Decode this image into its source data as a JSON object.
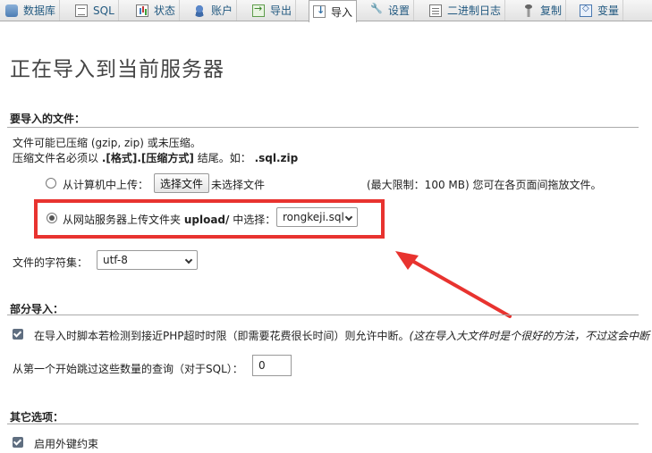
{
  "tabs": [
    {
      "label": "数据库",
      "icon": "database-icon"
    },
    {
      "label": "SQL",
      "icon": "sql-icon"
    },
    {
      "label": "状态",
      "icon": "status-icon"
    },
    {
      "label": "账户",
      "icon": "user-icon"
    },
    {
      "label": "导出",
      "icon": "export-icon"
    },
    {
      "label": "导入",
      "icon": "import-icon",
      "active": true
    },
    {
      "label": "设置",
      "icon": "wrench-icon"
    },
    {
      "label": "二进制日志",
      "icon": "binlog-icon"
    },
    {
      "label": "复制",
      "icon": "replication-icon"
    },
    {
      "label": "变量",
      "icon": "variables-icon"
    }
  ],
  "page_title": "正在导入到当前服务器",
  "file_section": {
    "heading": "要导入的文件：",
    "note_line1": "文件可能已压缩 (gzip, zip) 或未压缩。",
    "note_line2_prefix": "压缩文件名必须以",
    "note_line2_format": ".[格式].[压缩方式]",
    "note_line2_mid": "结尾。如：",
    "note_line2_example": ".sql.zip",
    "upload_from_computer_label": "从计算机中上传：",
    "choose_file_button": "选择文件",
    "no_file_selected": "未选择文件",
    "max_limit_text": "(最大限制：100 MB) 您可在各页面间拖放文件。",
    "upload_from_server_prefix": "从网站服务器上传文件夹",
    "upload_dir": "upload/",
    "upload_from_server_suffix": "中选择：",
    "server_file_selected": "rongkeji.sql",
    "charset_label": "文件的字符集：",
    "charset_value": "utf-8"
  },
  "partial_section": {
    "heading": "部分导入：",
    "interrupt_text": "在导入时脚本若检测到接近PHP超时时限（即需要花费很长时间）则允许中断。",
    "interrupt_note": "(这在导入大文件时是个很好的方法，不过这会中断",
    "skip_label": "从第一个开始跳过这些数量的查询（对于SQL）：",
    "skip_value": "0"
  },
  "other_section": {
    "heading": "其它选项：",
    "fk_label": "启用外键约束"
  },
  "colors": {
    "highlight": "#e8332f",
    "link": "#235a81"
  }
}
